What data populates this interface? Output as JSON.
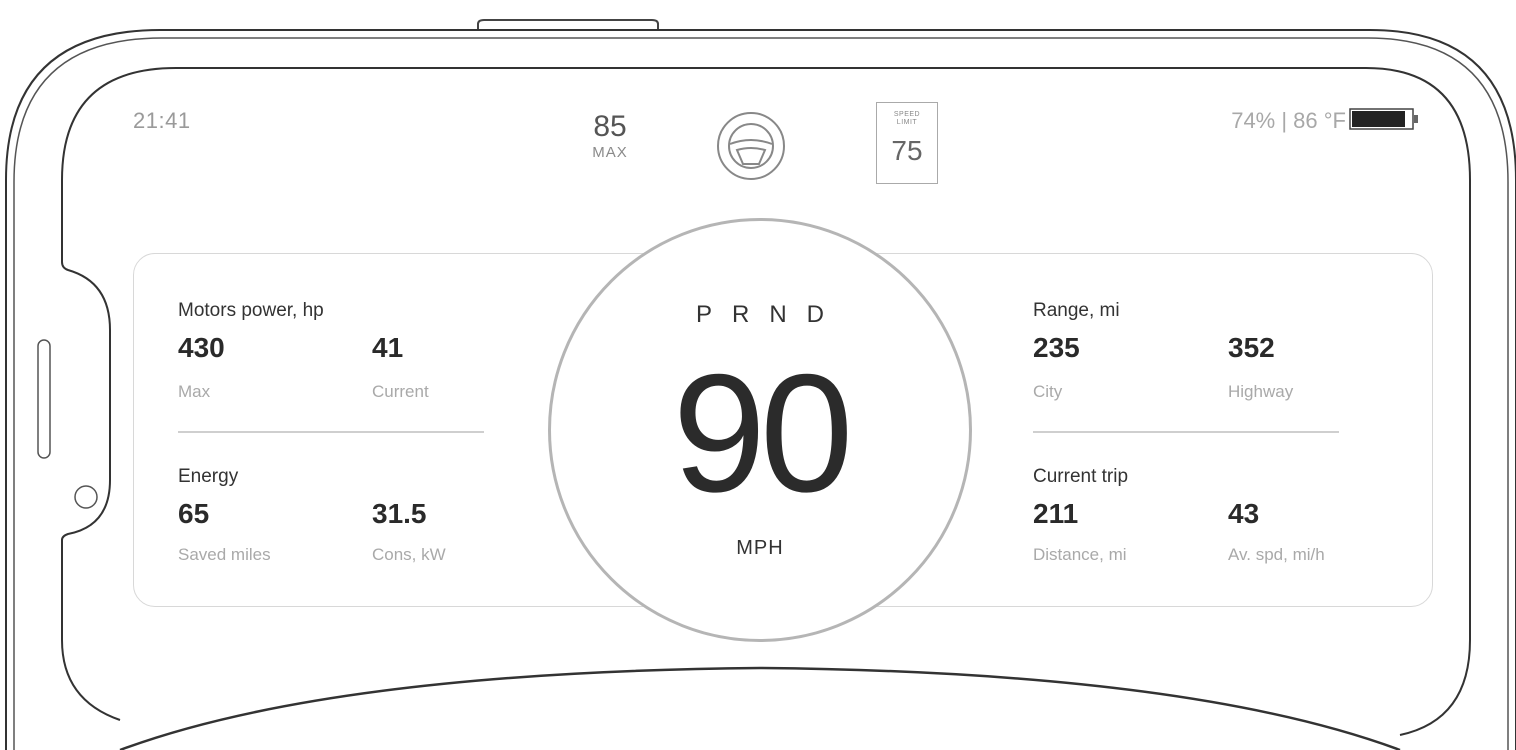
{
  "status_bar": {
    "time": "21:41",
    "cruise": {
      "value": "85",
      "label": "MAX"
    },
    "speed_limit": {
      "caption": "SPEED LIMIT",
      "value": "75"
    },
    "status_text": "74% | 86 °F",
    "battery_level": 0.9,
    "wheel_icon": "steering-wheel-icon",
    "battery_icon": "battery-icon"
  },
  "drive": {
    "gears": [
      "P",
      "R",
      "N",
      "D"
    ],
    "speed": "90",
    "unit": "MPH"
  },
  "left": {
    "motors": {
      "title": "Motors power, hp",
      "items": [
        {
          "value": "430",
          "label": "Max"
        },
        {
          "value": "41",
          "label": "Current"
        }
      ]
    },
    "energy": {
      "title": "Energy",
      "items": [
        {
          "value": "65",
          "label": "Saved miles"
        },
        {
          "value": "31.5",
          "label": "Cons, kW"
        }
      ]
    }
  },
  "right": {
    "range": {
      "title": "Range, mi",
      "items": [
        {
          "value": "235",
          "label": "City"
        },
        {
          "value": "352",
          "label": "Highway"
        }
      ]
    },
    "trip": {
      "title": "Current trip",
      "items": [
        {
          "value": "211",
          "label": "Distance, mi"
        },
        {
          "value": "43",
          "label": "Av. spd, mi/h"
        }
      ]
    }
  }
}
